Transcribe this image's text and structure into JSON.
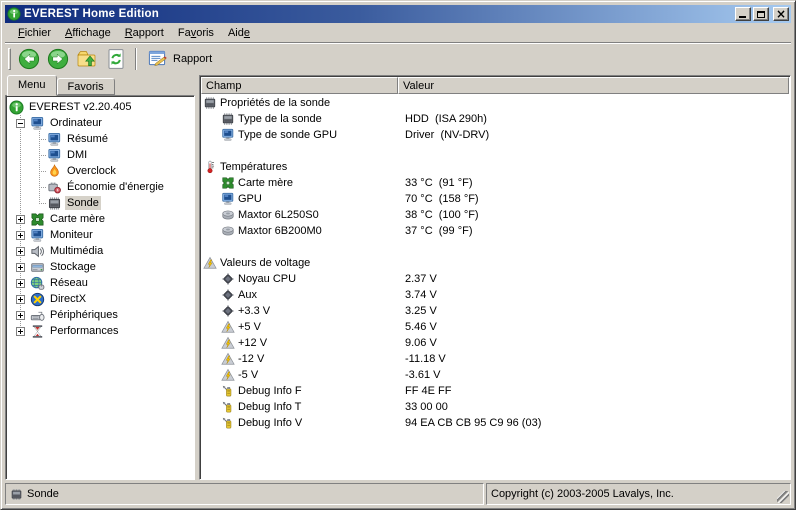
{
  "window": {
    "title": "EVEREST Home Edition",
    "app_icon": "app-logo",
    "close_glyph": "×",
    "controls": [
      "minimize",
      "maximize",
      "close"
    ]
  },
  "menu_bar": {
    "items": [
      {
        "label": "Fichier",
        "mnemonic_index": 0
      },
      {
        "label": "Affichage",
        "mnemonic_index": 0
      },
      {
        "label": "Rapport",
        "mnemonic_index": 0
      },
      {
        "label": "Favoris",
        "mnemonic_index": 2
      },
      {
        "label": "Aide",
        "mnemonic_index": 3
      }
    ]
  },
  "toolbar": {
    "buttons": [
      {
        "name": "back",
        "icon": "back"
      },
      {
        "name": "forward",
        "icon": "forward"
      },
      {
        "name": "up",
        "icon": "up-folder"
      },
      {
        "name": "refresh",
        "icon": "refresh"
      },
      {
        "name": "separator"
      },
      {
        "name": "report",
        "icon": "report",
        "label": "Rapport"
      }
    ]
  },
  "sidebar": {
    "tabs": [
      {
        "label": "Menu",
        "active": true
      },
      {
        "label": "Favoris",
        "active": false
      }
    ],
    "tree": [
      {
        "level": 0,
        "icon": "app-logo",
        "label": "EVEREST v2.20.405"
      },
      {
        "level": 1,
        "expander": "minus",
        "icon": "computer",
        "label": "Ordinateur"
      },
      {
        "level": 2,
        "icon": "computer",
        "label": "Résumé"
      },
      {
        "level": 2,
        "icon": "computer",
        "label": "DMI"
      },
      {
        "level": 2,
        "icon": "flame",
        "label": "Overclock"
      },
      {
        "level": 2,
        "icon": "energy",
        "label": "Économie d'énergie"
      },
      {
        "level": 2,
        "icon": "chip",
        "label": "Sonde",
        "selected": true,
        "last_child": true
      },
      {
        "level": 1,
        "expander": "plus",
        "icon": "motherboard",
        "label": "Carte mère"
      },
      {
        "level": 1,
        "expander": "plus",
        "icon": "computer",
        "label": "Moniteur"
      },
      {
        "level": 1,
        "expander": "plus",
        "icon": "speaker",
        "label": "Multimédia"
      },
      {
        "level": 1,
        "expander": "plus",
        "icon": "storage",
        "label": "Stockage"
      },
      {
        "level": 1,
        "expander": "plus",
        "icon": "network",
        "label": "Réseau"
      },
      {
        "level": 1,
        "expander": "plus",
        "icon": "directx",
        "label": "DirectX"
      },
      {
        "level": 1,
        "expander": "plus",
        "icon": "devices",
        "label": "Périphériques"
      },
      {
        "level": 1,
        "expander": "plus",
        "icon": "hourglass",
        "label": "Performances",
        "last_sibling": true
      }
    ]
  },
  "content": {
    "columns": [
      "Champ",
      "Valeur"
    ],
    "rows": [
      {
        "type": "group",
        "icon": "chip",
        "field": "Propriétés de la sonde",
        "value": ""
      },
      {
        "type": "item",
        "icon": "chip",
        "field": "Type de la sonde",
        "value": "HDD  (ISA 290h)"
      },
      {
        "type": "item",
        "icon": "computer",
        "field": "Type de sonde GPU",
        "value": "Driver  (NV-DRV)"
      },
      {
        "type": "blank"
      },
      {
        "type": "group",
        "icon": "thermometer",
        "field": "Températures",
        "value": ""
      },
      {
        "type": "item",
        "icon": "motherboard",
        "field": "Carte mère",
        "value": "33 °C  (91 °F)"
      },
      {
        "type": "item",
        "icon": "computer",
        "field": "GPU",
        "value": "70 °C  (158 °F)"
      },
      {
        "type": "item",
        "icon": "hdd",
        "field": "Maxtor 6L250S0",
        "value": "38 °C  (100 °F)"
      },
      {
        "type": "item",
        "icon": "hdd",
        "field": "Maxtor 6B200M0",
        "value": "37 °C  (99 °F)"
      },
      {
        "type": "blank"
      },
      {
        "type": "group",
        "icon": "voltage",
        "field": "Valeurs de voltage",
        "value": ""
      },
      {
        "type": "item",
        "icon": "cpu",
        "field": "Noyau CPU",
        "value": "2.37 V"
      },
      {
        "type": "item",
        "icon": "cpu",
        "field": "Aux",
        "value": "3.74 V"
      },
      {
        "type": "item",
        "icon": "cpu",
        "field": "+3.3 V",
        "value": "3.25 V"
      },
      {
        "type": "item",
        "icon": "voltage",
        "field": "+5 V",
        "value": "5.46 V"
      },
      {
        "type": "item",
        "icon": "voltage",
        "field": "+12 V",
        "value": "9.06 V"
      },
      {
        "type": "item",
        "icon": "voltage",
        "field": "-12 V",
        "value": "-11.18 V"
      },
      {
        "type": "item",
        "icon": "voltage",
        "field": "-5 V",
        "value": "-3.61 V"
      },
      {
        "type": "item",
        "icon": "debug",
        "field": "Debug Info F",
        "value": "FF 4E FF"
      },
      {
        "type": "item",
        "icon": "debug",
        "field": "Debug Info T",
        "value": "33 00 00"
      },
      {
        "type": "item",
        "icon": "debug",
        "field": "Debug Info V",
        "value": "94 EA CB CB 95 C9 96 (03)"
      }
    ]
  },
  "status_bar": {
    "left_icon": "chip",
    "left_text": "Sonde",
    "right_text": "Copyright (c) 2003-2005 Lavalys, Inc."
  },
  "colors": {
    "chrome": "#D4D0C8",
    "titlebar_start": "#0F2B7D",
    "titlebar_end": "#A6CAF0",
    "selection": "#D6D2C9",
    "accent_green": "#3FAE3F"
  }
}
